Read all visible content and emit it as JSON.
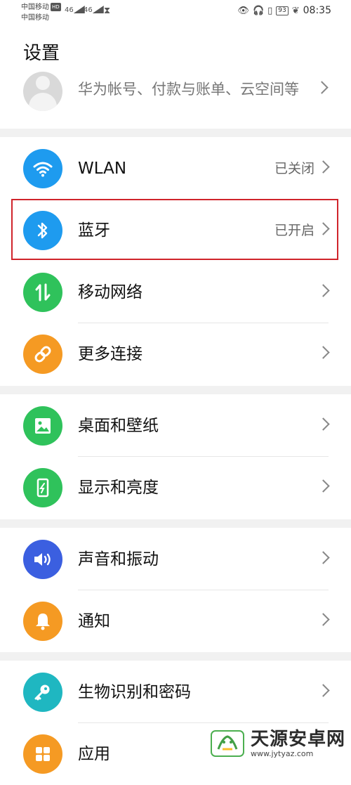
{
  "status_bar": {
    "carrier_1": "中国移动",
    "hd_badge": "HD",
    "carrier_2": "中国移动",
    "sig1": "46",
    "sig2": "46",
    "battery": "93",
    "time": "08:35"
  },
  "page_title": "设置",
  "account": {
    "text": "华为帐号、付款与账单、云空间等"
  },
  "sections": {
    "wlan": {
      "label": "WLAN",
      "value": "已关闭",
      "color": "#1e9bef"
    },
    "bluetooth": {
      "label": "蓝牙",
      "value": "已开启",
      "color": "#1e9bef"
    },
    "mobile": {
      "label": "移动网络",
      "value": "",
      "color": "#2fc25b"
    },
    "more": {
      "label": "更多连接",
      "value": "",
      "color": "#f59a23"
    },
    "wallpaper": {
      "label": "桌面和壁纸",
      "value": "",
      "color": "#2fc25b"
    },
    "display": {
      "label": "显示和亮度",
      "value": "",
      "color": "#2fc25b"
    },
    "sound": {
      "label": "声音和振动",
      "value": "",
      "color": "#3b5fe0"
    },
    "notify": {
      "label": "通知",
      "value": "",
      "color": "#f59a23"
    },
    "biometric": {
      "label": "生物识别和密码",
      "value": "",
      "color": "#1fb7c1"
    },
    "apps": {
      "label": "应用",
      "value": "",
      "color": "#f59a23"
    }
  },
  "highlight_color": "#d0242b",
  "watermark": {
    "name": "天源安卓网",
    "url": "www.jytyaz.com"
  }
}
